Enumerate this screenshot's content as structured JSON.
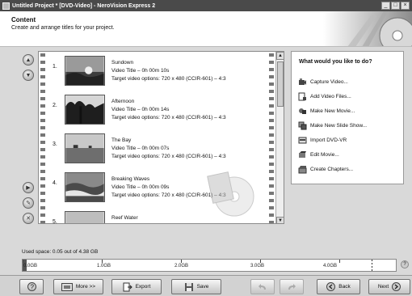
{
  "window": {
    "title": "Untitled Project * [DVD-Video] - NeroVision Express 2"
  },
  "header": {
    "title": "Content",
    "subtitle": "Create and arrange titles for your project."
  },
  "titles": [
    {
      "number": "1.",
      "name": "Sundown",
      "duration": "Video Title – 0h 00m 10s",
      "target": "Target video options: 720 x 480 (CCIR-601) – 4:3"
    },
    {
      "number": "2.",
      "name": "Afternoon",
      "duration": "Video Title – 0h 00m 14s",
      "target": "Target video options: 720 x 480 (CCIR-601) – 4:3"
    },
    {
      "number": "3.",
      "name": "The Bay",
      "duration": "Video Title – 0h 00m 07s",
      "target": "Target video options: 720 x 480 (CCIR-601) – 4:3"
    },
    {
      "number": "4.",
      "name": "Breaking Waves",
      "duration": "Video Title – 0h 00m 09s",
      "target": "Target video options: 720 x 480 (CCIR-601) – 4:3"
    },
    {
      "number": "5.",
      "name": "Reef Water",
      "duration": "",
      "target": ""
    }
  ],
  "tasks": {
    "heading": "What would you like to do?",
    "items": [
      {
        "label": "Capture Video...",
        "icon": "camcorder-icon"
      },
      {
        "label": "Add Video Files...",
        "icon": "add-file-icon"
      },
      {
        "label": "Make New Movie...",
        "icon": "new-movie-icon"
      },
      {
        "label": "Make New Slide Show...",
        "icon": "slideshow-icon"
      },
      {
        "label": "Import DVD-VR",
        "icon": "import-disc-icon"
      },
      {
        "label": "Edit Movie...",
        "icon": "edit-movie-icon"
      },
      {
        "label": "Create Chapters...",
        "icon": "chapters-icon"
      }
    ]
  },
  "capacity": {
    "used_text": "Used space: 0.05 out of 4.38 GB",
    "used_gb": 0.05,
    "total_gb": 4.38,
    "ticks": [
      "0.0GB",
      "1.0GB",
      "2.0GB",
      "3.0GB",
      "4.0GB"
    ]
  },
  "buttons": {
    "help": "?",
    "more": "More >>",
    "export": "Export",
    "save": "Save",
    "back": "Back",
    "next": "Next"
  },
  "colors": {
    "titlebar": "#4a4a4a",
    "panel_bg": "#d9d9d9"
  }
}
